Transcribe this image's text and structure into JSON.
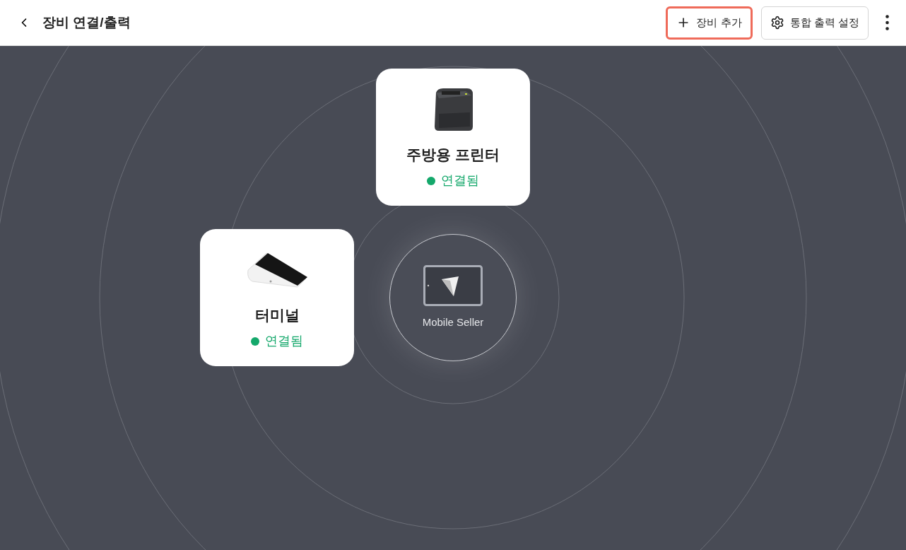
{
  "header": {
    "title": "장비 연결/출력",
    "actions": [
      {
        "kind": "add",
        "label": "장비 추가",
        "highlighted": true
      },
      {
        "kind": "settings",
        "label": "통합 출력 설정",
        "highlighted": false
      }
    ]
  },
  "hub": {
    "label": "Mobile Seller"
  },
  "devices": [
    {
      "kind": "printer",
      "name": "주방용 프린터",
      "status": "연결됨",
      "connected": true
    },
    {
      "kind": "terminal",
      "name": "터미널",
      "status": "연결됨",
      "connected": true
    }
  ]
}
